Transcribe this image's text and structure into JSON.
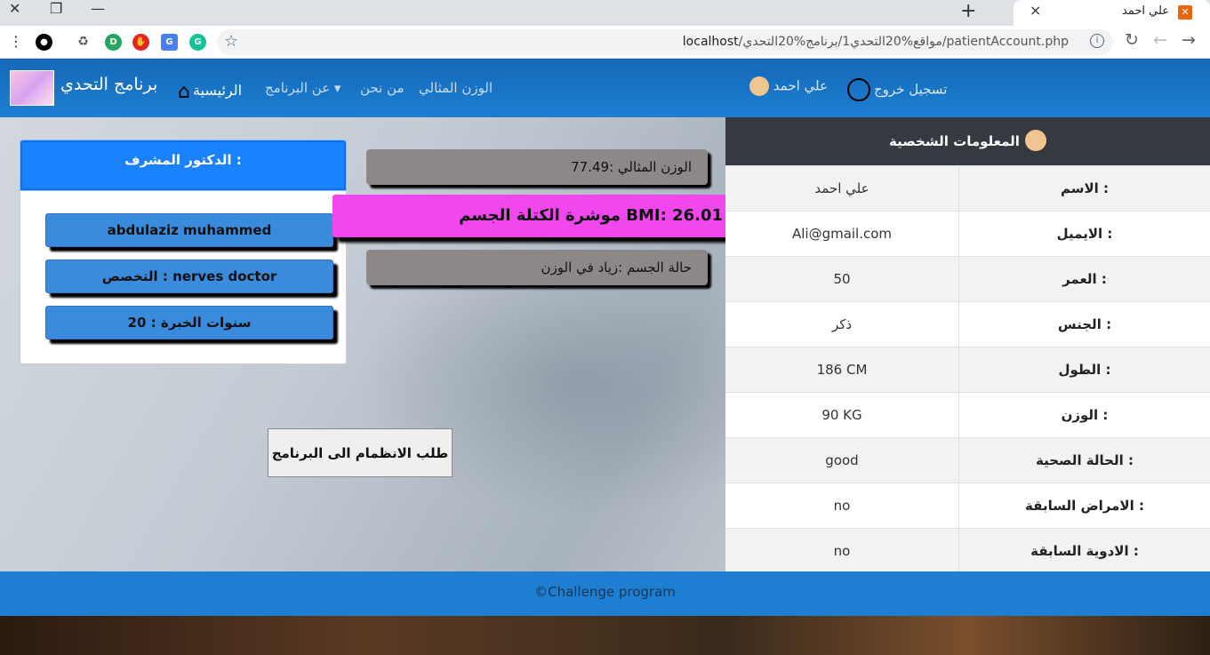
{
  "browser": {
    "tab_title": "علي احمد",
    "favicon": "xampp-icon",
    "url_host": "localhost",
    "url_path": "/مواقع%20التحدي1/برنامج%20التحدي/patientAccount.php",
    "window_controls": [
      "close-icon",
      "restore-icon",
      "minimize-icon"
    ]
  },
  "navbar": {
    "brand": "برنامج التحدي",
    "home": "الرئيسية",
    "about": "عن البرنامج",
    "who": "من نحن",
    "ideal": "الوزن المثالي",
    "user": "علي احمد",
    "logout": "تسجيل خروج",
    "bg_color": "#1d7ed2"
  },
  "personal_info": {
    "heading": "المعلومات الشخصية",
    "rows": [
      {
        "label": "الاسم :",
        "value": "علي احمد"
      },
      {
        "label": "الايميل :",
        "value": "Ali@gmail.com"
      },
      {
        "label": "العمر :",
        "value": "50"
      },
      {
        "label": "الجنس :",
        "value": "ذكر"
      },
      {
        "label": "الطول :",
        "value": "186 CM"
      },
      {
        "label": "الوزن :",
        "value": "90 KG"
      },
      {
        "label": "الحالة الصحية :",
        "value": "good"
      },
      {
        "label": "الامراض السابقة :",
        "value": "no"
      },
      {
        "label": "الادوية السابقة :",
        "value": "no"
      }
    ]
  },
  "stats": {
    "ideal_weight": "الوزن المثالي :77.49",
    "bmi": "موشرة الكتلة الجسم BMI: 26.01",
    "body_state": "حالة الجسم :زياد في الوزن",
    "bmi_color": "#f047ee"
  },
  "doctor": {
    "heading": "الدكتور المشرف :",
    "name": "abdulaziz muhammed",
    "specialty": "التخصص : nerves doctor",
    "experience": "سنوات الخبرة : 20"
  },
  "join_button": "طلب الانظمام الى البرنامج",
  "footer": "©Challenge program"
}
